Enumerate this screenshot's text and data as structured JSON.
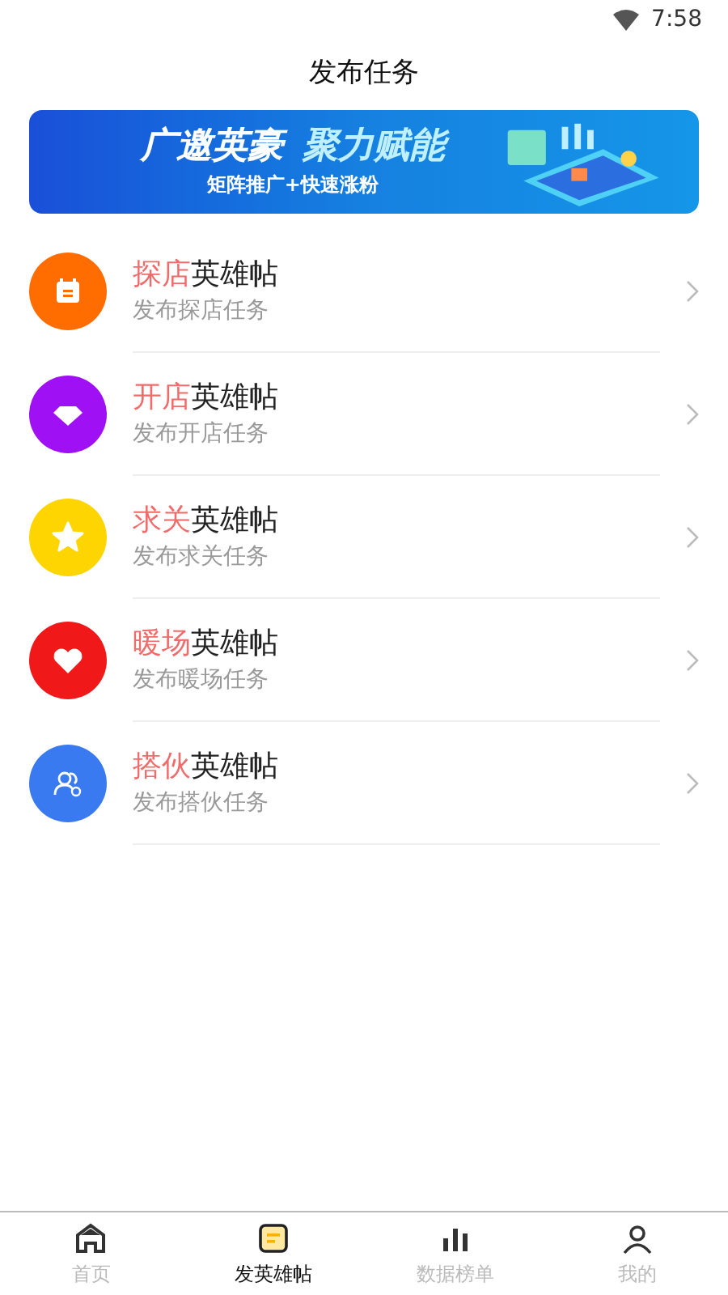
{
  "status_bar": {
    "time": "7:58"
  },
  "header": {
    "title": "发布任务"
  },
  "banner": {
    "headline_a": "广邀英豪",
    "headline_b": "聚力赋能",
    "subline": "矩阵推广+快速涨粉"
  },
  "tasks": [
    {
      "kind": "calendar",
      "color": "#ff6d00",
      "title_highlight": "探店",
      "title_rest": "英雄帖",
      "subtitle": "发布探店任务"
    },
    {
      "kind": "diamond",
      "color": "#a010f5",
      "title_highlight": "开店",
      "title_rest": "英雄帖",
      "subtitle": "发布开店任务"
    },
    {
      "kind": "star",
      "color": "#ffd500",
      "title_highlight": "求关",
      "title_rest": "英雄帖",
      "subtitle": "发布求关任务"
    },
    {
      "kind": "heart",
      "color": "#f01818",
      "title_highlight": "暖场",
      "title_rest": "英雄帖",
      "subtitle": "发布暖场任务"
    },
    {
      "kind": "people",
      "color": "#3a7af0",
      "title_highlight": "搭伙",
      "title_rest": "英雄帖",
      "subtitle": "发布搭伙任务"
    }
  ],
  "tab_bar": [
    {
      "kind": "home",
      "label": "首页",
      "selected": false
    },
    {
      "kind": "post",
      "label": "发英雄帖",
      "selected": true
    },
    {
      "kind": "rank",
      "label": "数据榜单",
      "selected": false
    },
    {
      "kind": "me",
      "label": "我的",
      "selected": false
    }
  ]
}
